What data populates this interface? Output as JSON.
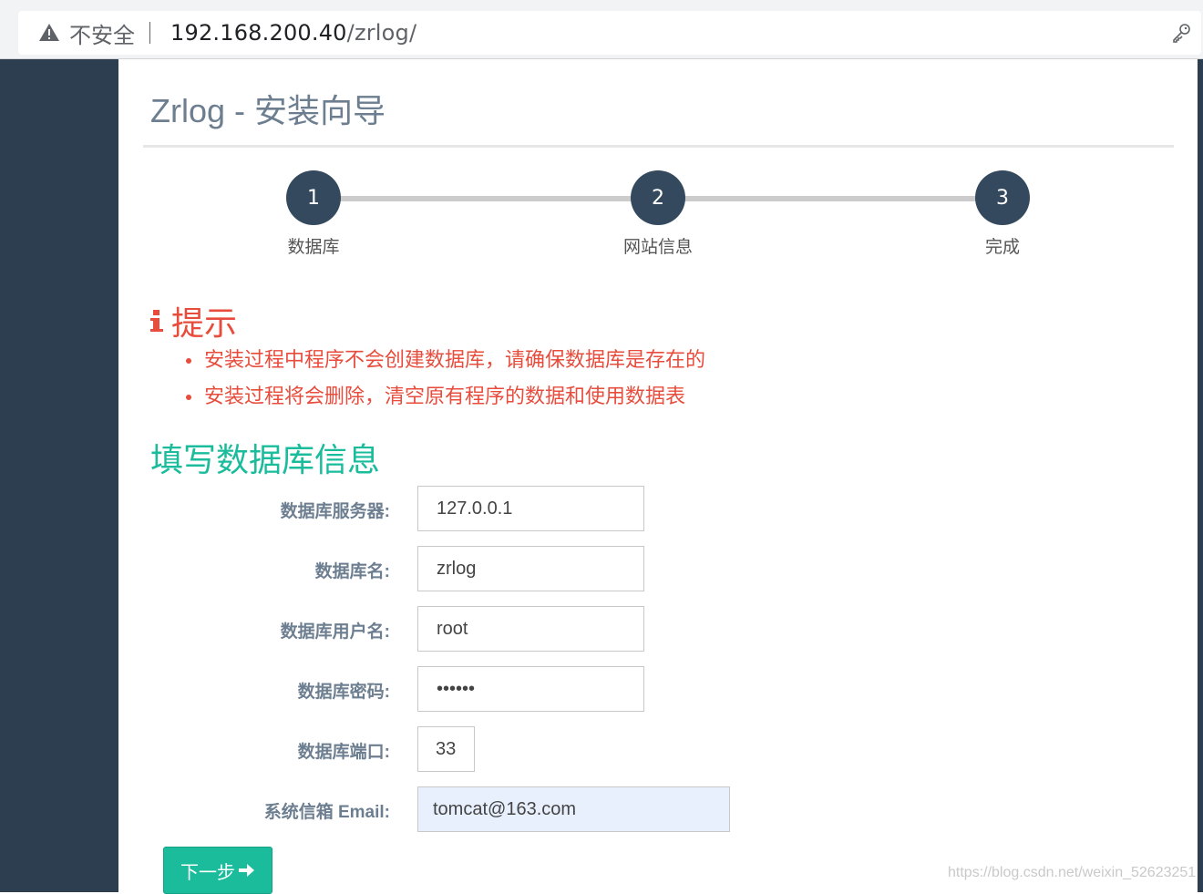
{
  "browser": {
    "security_label": "不安全",
    "url_host": "192.168.200.40",
    "url_path": "/zrlog/"
  },
  "page": {
    "title": "Zrlog - 安装向导"
  },
  "steps": [
    {
      "number": "1",
      "label": "数据库"
    },
    {
      "number": "2",
      "label": "网站信息"
    },
    {
      "number": "3",
      "label": "完成"
    }
  ],
  "tips": {
    "title": "提示",
    "items": [
      "安装过程中程序不会创建数据库，请确保数据库是存在的",
      "安装过程将会删除，清空原有程序的数据和使用数据表"
    ]
  },
  "form": {
    "section_title": "填写数据库信息",
    "fields": [
      {
        "label": "数据库服务器:",
        "value": "127.0.0.1"
      },
      {
        "label": "数据库名:",
        "value": "zrlog"
      },
      {
        "label": "数据库用户名:",
        "value": "root"
      },
      {
        "label": "数据库密码:",
        "value": "••••••"
      },
      {
        "label": "数据库端口:",
        "value": "33"
      },
      {
        "label": "系统信箱 Email:",
        "value": "tomcat@163.com"
      }
    ],
    "next_label": "下一步"
  },
  "watermark": "https://blog.csdn.net/weixin_52623251",
  "colors": {
    "sidebar": "#2c3e50",
    "step_circle": "#34495e",
    "tip_red": "#e74c3c",
    "section_green": "#1abc9c",
    "button_green": "#1abc9c"
  }
}
